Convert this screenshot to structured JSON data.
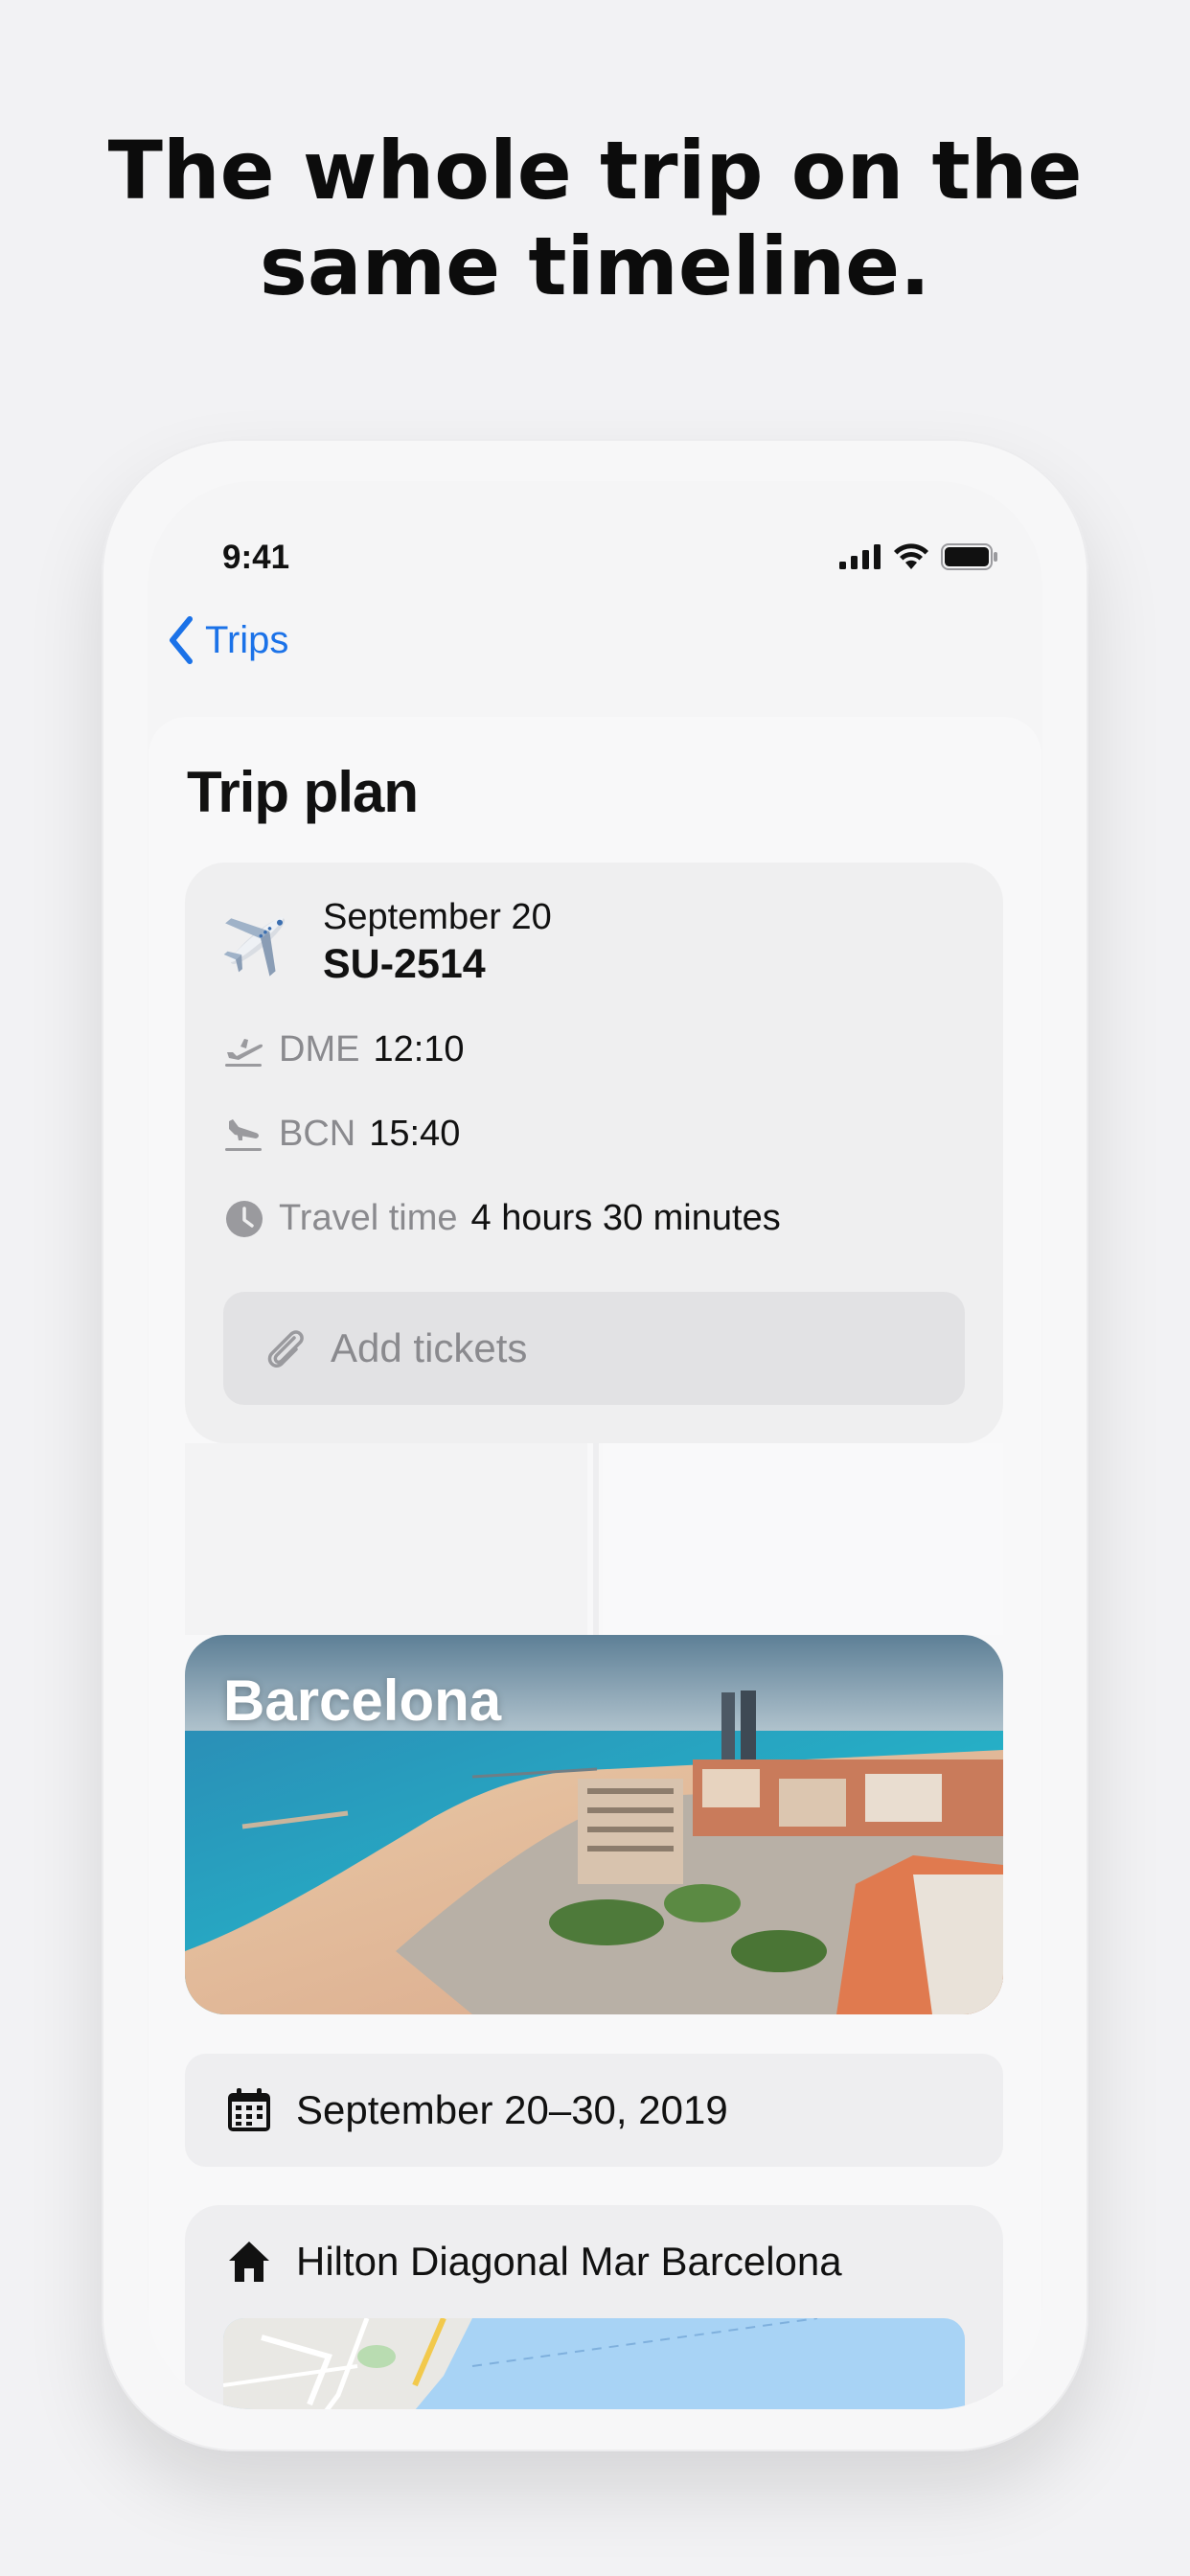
{
  "headline": {
    "line1": "The whole trip on the",
    "line2": "same timeline."
  },
  "status_bar": {
    "time": "9:41",
    "icons": [
      "cellular-signal-icon",
      "wifi-icon",
      "battery-icon"
    ]
  },
  "nav": {
    "back_label": "Trips",
    "accent_color": "#1b72e8"
  },
  "trip_plan": {
    "title": "Trip plan",
    "flight": {
      "icon": "airplane-emoji",
      "date": "September 20",
      "number": "SU-2514",
      "departure": {
        "airport": "DME",
        "time": "12:10"
      },
      "arrival": {
        "airport": "BCN",
        "time": "15:40"
      },
      "travel_time": {
        "label": "Travel time",
        "value": "4 hours 30 minutes"
      },
      "add_tickets_label": "Add tickets"
    },
    "destination": {
      "city": "Barcelona",
      "dates": "September 20–30, 2019",
      "hotel": "Hilton Diagonal Mar Barcelona"
    }
  }
}
